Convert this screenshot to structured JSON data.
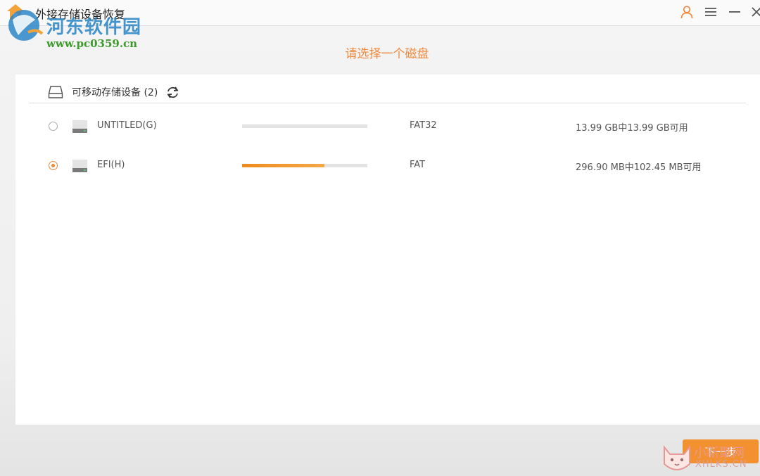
{
  "window": {
    "title": "外接存储设备恢复"
  },
  "titlebar_icons": [
    "user-icon",
    "menu-icon",
    "minimize-icon",
    "close-icon"
  ],
  "watermark_top": {
    "name": "河东软件园",
    "url": "www.pc0359.cn"
  },
  "heading": "请选择一个磁盘",
  "group": {
    "title": "可移动存储设备 (2)"
  },
  "drives": [
    {
      "name": "UNTITLED(G)",
      "filesystem": "FAT32",
      "capacity": "13.99 GB中13.99 GB可用",
      "used_fraction": 0.0,
      "selected": false
    },
    {
      "name": "EFI(H)",
      "filesystem": "FAT",
      "capacity": "296.90 MB中102.45 MB可用",
      "used_fraction": 0.655,
      "selected": true
    }
  ],
  "next_button": "下一步",
  "watermark_bottom": {
    "name": "小新聚网",
    "url": "XHLKS.CN"
  },
  "colors": {
    "accent": "#f0883c",
    "button": "#f3902f",
    "bar_bg": "#e3e3e3"
  }
}
